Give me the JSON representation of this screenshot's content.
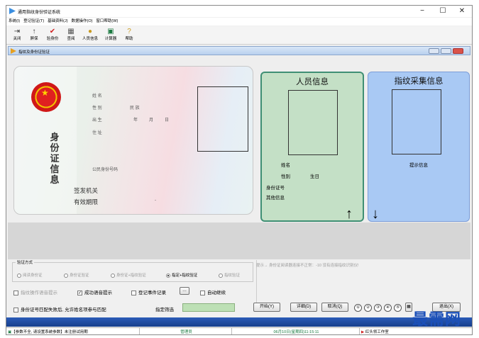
{
  "window": {
    "title": "通用指纹身份验证系统",
    "min": "−",
    "max": "☐",
    "close": "✕"
  },
  "menu": [
    "系统(I)",
    "登记验证(T)",
    "基础资料(J)",
    "数据操作(O)",
    "窗口帮助(W)"
  ],
  "toolbar": [
    {
      "label": "关闭",
      "icon": "⇥",
      "color": "#333"
    },
    {
      "label": "屏保",
      "icon": "↑",
      "color": "#333"
    },
    {
      "label": "验身份",
      "icon": "✔",
      "color": "#d02020"
    },
    {
      "label": "查阅",
      "icon": "▦",
      "color": "#555"
    },
    {
      "label": "人员信息",
      "icon": "●",
      "color": "#c89a20"
    },
    {
      "label": "计算器",
      "icon": "▣",
      "color": "#1a7a40"
    },
    {
      "label": "帮助",
      "icon": "?",
      "color": "#c89a20"
    }
  ],
  "child": {
    "title": "指纹及身份证验证"
  },
  "idcard": {
    "title": "身份证信息",
    "name_label": "姓 名",
    "gender_label": "性 别",
    "ethnic_label": "民 族",
    "birth_label": "出 生",
    "year": "年",
    "month": "月",
    "day": "日",
    "address_label": "住 址",
    "id_label": "公民身份号码",
    "issuer_label": "签发机关",
    "valid_label": "有效期限",
    "dash": "-"
  },
  "person": {
    "heading": "人员信息",
    "name": "姓名",
    "gender": "性别",
    "birthday": "生日",
    "idno": "身份证号",
    "other": "其他信息"
  },
  "fingerprint": {
    "heading": "指纹采集信息",
    "hint": "提示信息"
  },
  "verify": {
    "legend": "验证方式",
    "options": [
      "阅读身份证",
      "身份证验证",
      "身份证+指纹验证",
      "指定+指纹验证",
      "指纹验证"
    ],
    "selected": 3
  },
  "hint_text": "提示→ 身份证阅读器连接不正常：-10  没有连接指纹识别仪!",
  "options": {
    "voice_prompt": "指纹操作语音提示",
    "success_voice": "成功语音提示",
    "log_events": "登记事件记录",
    "log_browse": "…",
    "auto_continue": "自动继续",
    "allow_name": "身份证号匹配失败后, 允许姓名项参与匹配",
    "specify_label": "指定筛选"
  },
  "buttons": {
    "start": "开始(Y)",
    "detail": "详细(D)",
    "cancel": "取消(Q)",
    "exit": "退出(X)"
  },
  "circles": [
    "①",
    "②",
    "③",
    "④",
    "⑤"
  ],
  "status": {
    "cell1": "【参数不全, 请设置系统参数】未注册试用期",
    "cell2": "管理员",
    "cell3": "06月10日(星期四)11:15:11",
    "cell4": "红头领工作室"
  },
  "watermark": "最需网"
}
